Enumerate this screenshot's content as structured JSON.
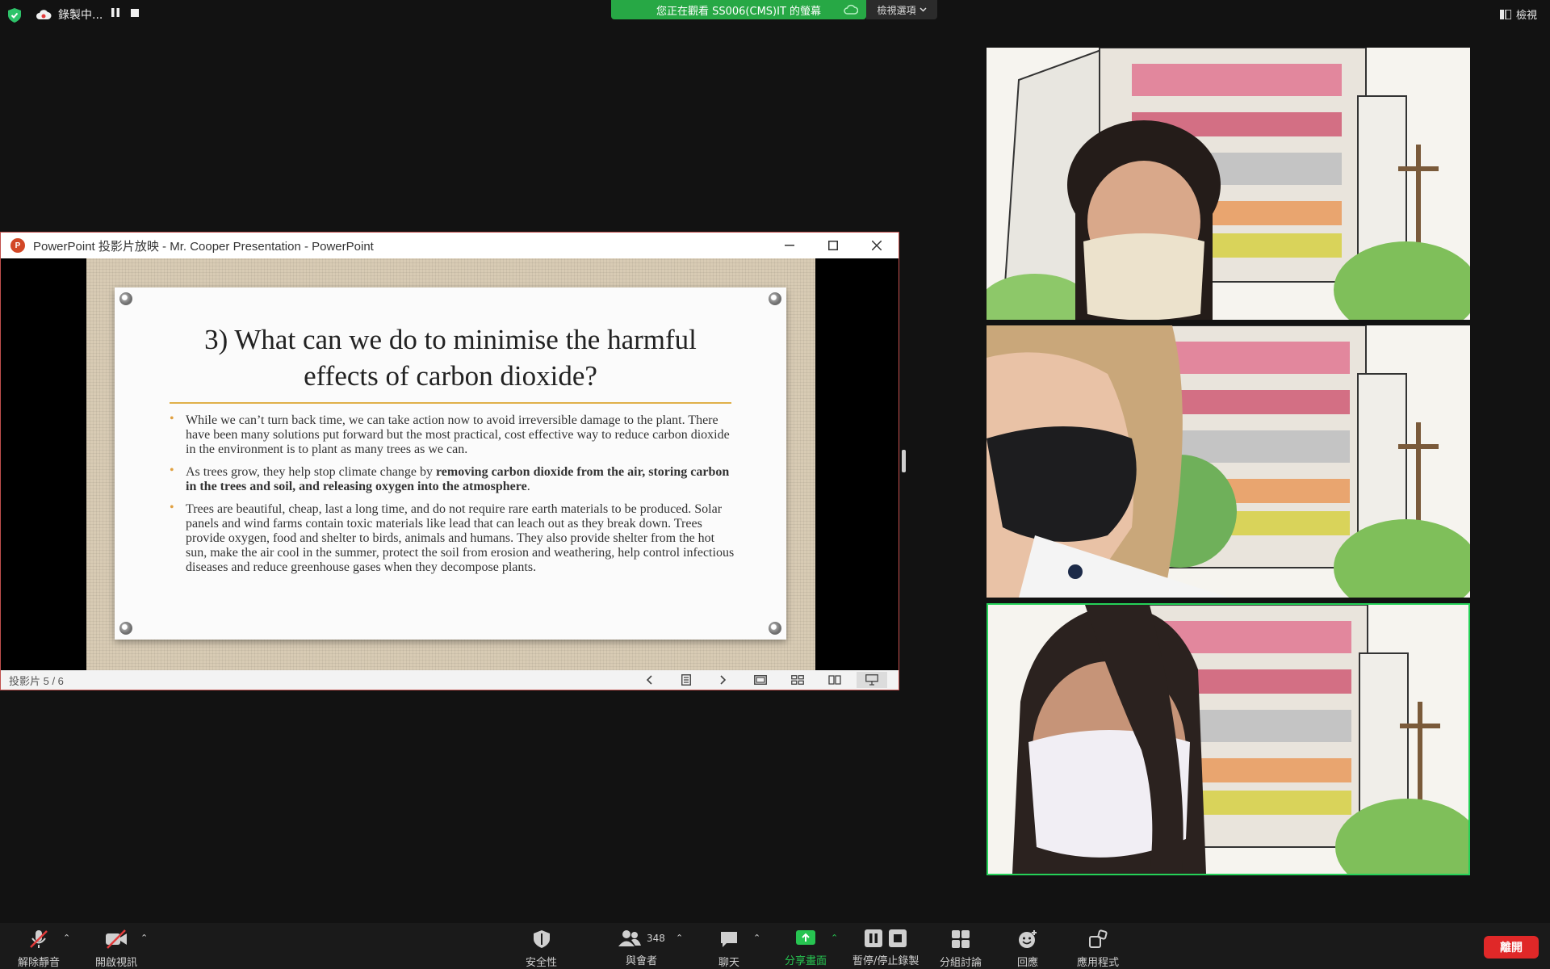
{
  "top_bar": {
    "recording_label": "錄製中...",
    "banner_text": "您正在觀看 SS006(CMS)IT 的螢幕",
    "view_options_label": "檢視選項",
    "view_label": "檢視"
  },
  "powerpoint": {
    "window_title": "PowerPoint 投影片放映  -  Mr. Cooper Presentation - PowerPoint",
    "logo_letter": "P",
    "slide": {
      "title_line1": "3) What can we do to minimise the harmful",
      "title_line2": "effects of carbon dioxide?",
      "bullet1": "While we can’t turn back time, we can take action now to avoid irreversible damage to the plant. There have been many solutions put forward but the most practical, cost effective way to reduce carbon dioxide in the environment is to plant as many trees as we can.",
      "bullet2_pre": "As trees grow, they help stop climate change by ",
      "bullet2_bold": "removing carbon dioxide from the air, storing carbon in the trees and soil, and releasing oxygen into the atmosphere",
      "bullet2_post": ".",
      "bullet3": "Trees are beautiful, cheap, last a long time, and do not require rare earth materials to be produced. Solar panels and wind farms contain toxic materials like lead that can leach out as they break down. Trees provide oxygen, food and shelter to birds, animals and humans. They also provide shelter from the hot sun, make the air cool in the summer, protect the soil from erosion and weathering, help control infectious diseases and reduce greenhouse gases when they decompose plants."
    },
    "status_slide_count": "投影片 5 / 6"
  },
  "toolbar": {
    "mute_label": "解除靜音",
    "video_label": "開啟視訊",
    "security_label": "安全性",
    "participants_label": "與會者",
    "participants_count": "348",
    "chat_label": "聊天",
    "share_label": "分享畫面",
    "record_label": "暫停/停止錄製",
    "breakout_label": "分組討論",
    "reactions_label": "回應",
    "apps_label": "應用程式",
    "leave_label": "離開"
  },
  "colors": {
    "banner_green": "#27a845",
    "active_tile_border": "#25d158",
    "leave_red": "#e02828",
    "slide_accent": "#e0b04a"
  }
}
